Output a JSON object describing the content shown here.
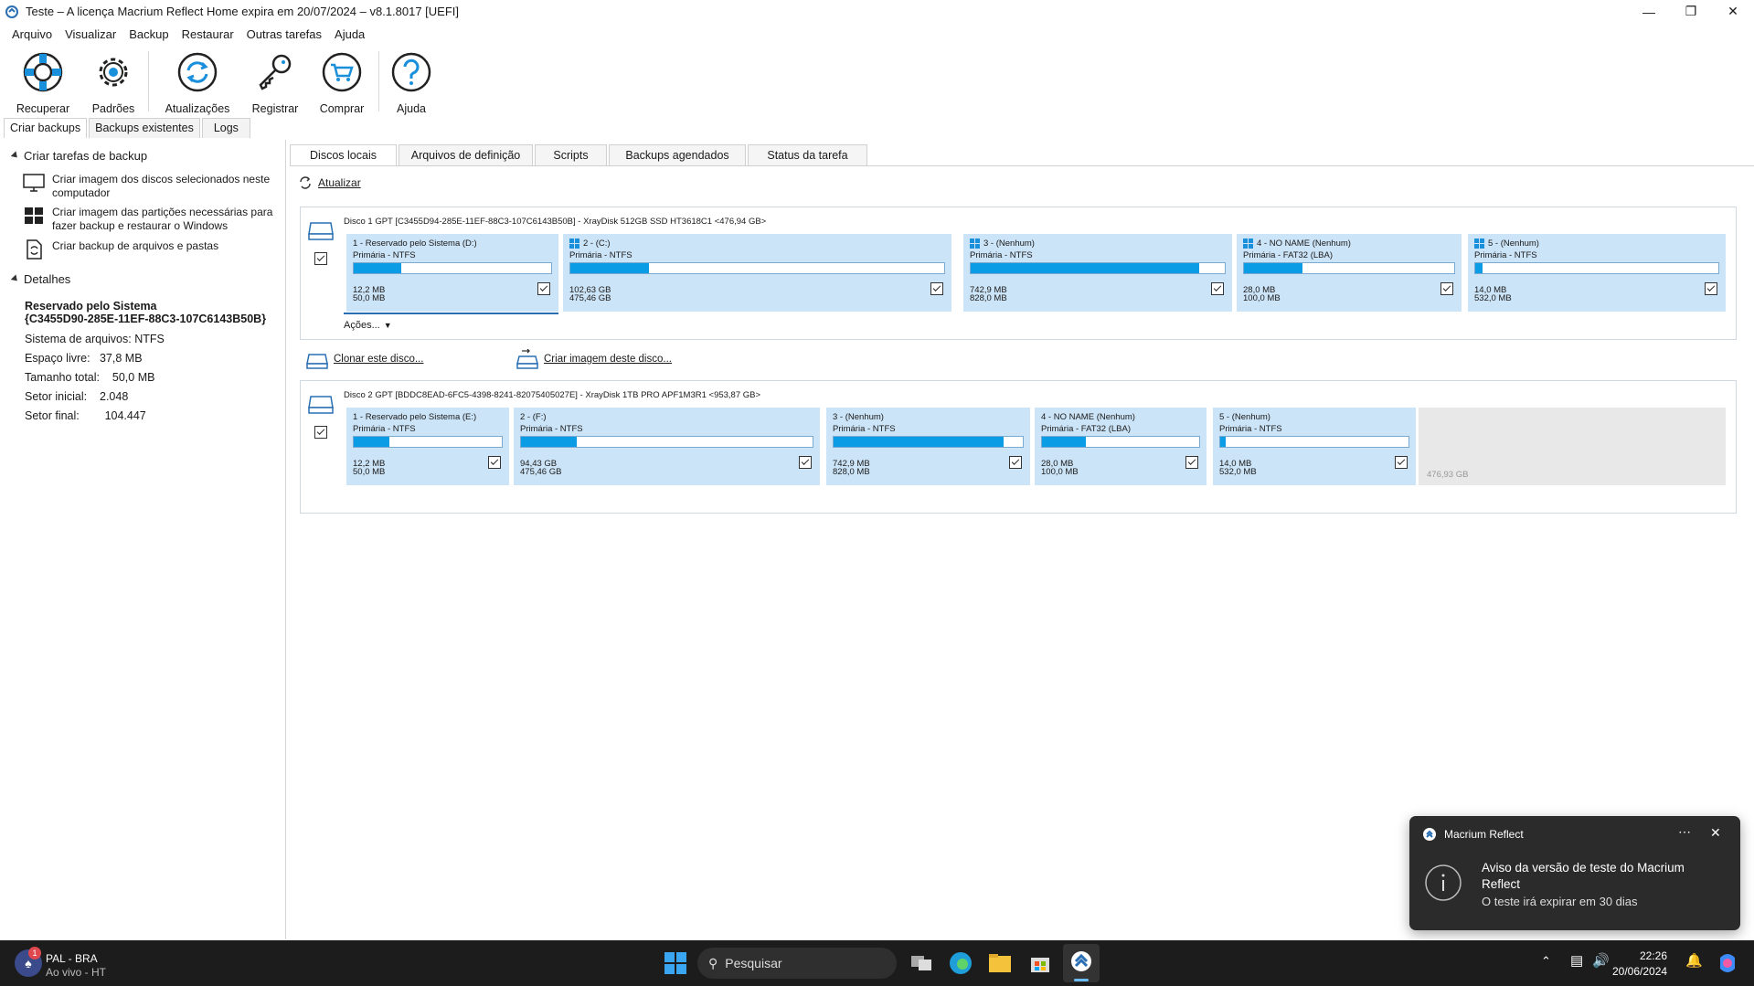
{
  "window": {
    "title": "Teste – A licença Macrium Reflect Home expira em 20/07/2024 – v8.1.8017  [UEFI]"
  },
  "menu": [
    "Arquivo",
    "Visualizar",
    "Backup",
    "Restaurar",
    "Outras tarefas",
    "Ajuda"
  ],
  "toolbar": {
    "recover": "Recuperar",
    "defaults": "Padrões",
    "updates": "Atualizações",
    "register": "Registrar",
    "buy": "Comprar",
    "help": "Ajuda"
  },
  "left_tabs": [
    "Criar backups",
    "Backups existentes",
    "Logs"
  ],
  "left": {
    "tasks_header": "Criar tarefas de backup",
    "task1": "Criar imagem dos discos selecionados neste computador",
    "task2": "Criar imagem das partições necessárias para fazer backup e restaurar o Windows",
    "task3": "Criar backup de arquivos e pastas",
    "details_header": "Detalhes",
    "detail_name": "Reservado pelo Sistema",
    "detail_guid": "{C3455D90-285E-11EF-88C3-107C6143B50B}",
    "fs": "Sistema de arquivos: NTFS",
    "free_label": "Espaço livre:",
    "free_value": "37,8 MB",
    "total_label": "Tamanho total:",
    "total_value": "50,0 MB",
    "start_label": "Setor inicial:",
    "start_value": "2.048",
    "end_label": "Setor final:",
    "end_value": "104.447"
  },
  "main_tabs": [
    "Discos locais",
    "Arquivos de definição",
    "Scripts",
    "Backups agendados",
    "Status da tarefa"
  ],
  "refresh": "Atualizar",
  "actions": "Ações...",
  "clone_disk": "Clonar este disco...",
  "image_disk": "Criar imagem deste disco...",
  "disk1": {
    "title": "Disco 1 GPT [C3455D94-285E-11EF-88C3-107C6143B50B] - XrayDisk 512GB SSD HT3618C1  <476,94 GB>",
    "partitions": [
      {
        "name": "1 - Reservado pelo Sistema (D:)",
        "type": "Primária - NTFS",
        "used": "12,2 MB",
        "total": "50,0 MB",
        "fill": 0.24,
        "win": false
      },
      {
        "name": "2 -  (C:)",
        "type": "Primária - NTFS",
        "used": "102,63 GB",
        "total": "475,46 GB",
        "fill": 0.21,
        "win": true
      },
      {
        "name": "3 -  (Nenhum)",
        "type": "Primária - NTFS",
        "used": "742,9 MB",
        "total": "828,0 MB",
        "fill": 0.9,
        "win": true
      },
      {
        "name": "4 - NO NAME (Nenhum)",
        "type": "Primária - FAT32 (LBA)",
        "used": "28,0 MB",
        "total": "100,0 MB",
        "fill": 0.28,
        "win": true
      },
      {
        "name": "5 -  (Nenhum)",
        "type": "Primária - NTFS",
        "used": "14,0 MB",
        "total": "532,0 MB",
        "fill": 0.03,
        "win": true
      }
    ]
  },
  "disk2": {
    "title": "Disco 2 GPT [BDDC8EAD-6FC5-4398-8241-82075405027E] - XrayDisk 1TB PRO APF1M3R1  <953,87 GB>",
    "partitions": [
      {
        "name": "1 - Reservado pelo Sistema (E:)",
        "type": "Primária - NTFS",
        "used": "12,2 MB",
        "total": "50,0 MB",
        "fill": 0.24
      },
      {
        "name": "2 -  (F:)",
        "type": "Primária - NTFS",
        "used": "94,43 GB",
        "total": "475,46 GB",
        "fill": 0.19
      },
      {
        "name": "3 -  (Nenhum)",
        "type": "Primária - NTFS",
        "used": "742,9 MB",
        "total": "828,0 MB",
        "fill": 0.9
      },
      {
        "name": "4 - NO NAME (Nenhum)",
        "type": "Primária - FAT32 (LBA)",
        "used": "28,0 MB",
        "total": "100,0 MB",
        "fill": 0.28
      },
      {
        "name": "5 -  (Nenhum)",
        "type": "Primária - NTFS",
        "used": "14,0 MB",
        "total": "532,0 MB",
        "fill": 0.03
      }
    ],
    "unallocated": "476,93 GB"
  },
  "toast": {
    "app": "Macrium Reflect",
    "title": "Aviso da versão de teste do Macrium Reflect",
    "body": "O teste irá expirar em 30 dias"
  },
  "taskbar": {
    "news_title": "PAL - BRA",
    "news_sub": "Ao vivo - HT",
    "badge": "1",
    "search": "Pesquisar",
    "time": "22:26",
    "date": "20/06/2024"
  },
  "colors": {
    "partition_bg": "#cce4f7",
    "bar_fill": "#0b9ce6",
    "taskbar_bg": "#1c1c1c",
    "toast_bg": "#2b2b2b"
  }
}
